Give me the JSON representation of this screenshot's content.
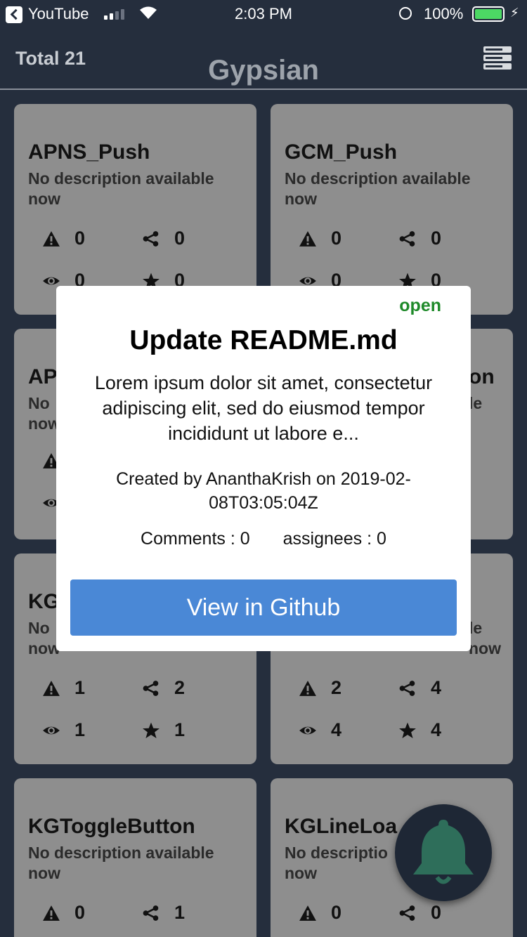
{
  "statusbar": {
    "app": "YouTube",
    "time": "2:03 PM",
    "battery": "100%"
  },
  "header": {
    "total": "Total 21",
    "title": "Gypsian"
  },
  "cards": [
    {
      "name": "APNS_Push",
      "desc": "No description available now",
      "issues": "0",
      "forks": "0",
      "watchers": "0",
      "stars": "0"
    },
    {
      "name": "GCM_Push",
      "desc": "No description available now",
      "issues": "0",
      "forks": "0",
      "watchers": "0",
      "stars": "0"
    },
    {
      "name": "AP",
      "desc": "No now",
      "name_right": "on",
      "desc_right": "le"
    },
    {
      "name": "KG",
      "desc": "No now",
      "issues": "1",
      "forks": "2",
      "watchers": "1",
      "stars": "1"
    },
    {
      "desc_right": "le now",
      "issues": "2",
      "forks": "4",
      "watchers": "4",
      "stars": "4"
    },
    {
      "name": "KGToggleButton",
      "desc": "No description available now",
      "issues": "0",
      "forks": "1"
    },
    {
      "name": "KGLineLoa",
      "desc": "No descriptio now",
      "issues": "0",
      "forks": "0"
    }
  ],
  "modal": {
    "status": "open",
    "title": "Update README.md",
    "body": "Lorem ipsum dolor sit amet, consectetur adipiscing elit, sed do eiusmod tempor incididunt ut labore e...",
    "created": "Created by AnanthaKrish on 2019-02-08T03:05:04Z",
    "comments": "Comments : 0",
    "assignees": "assignees : 0",
    "button": "View in Github"
  },
  "fab": {
    "icon": "bell-icon",
    "color": "#2e6e5a"
  },
  "colors": {
    "background": "#252e3d",
    "card": "#8e8e8e",
    "button": "#4a88d6",
    "open": "#1f8a2a"
  }
}
